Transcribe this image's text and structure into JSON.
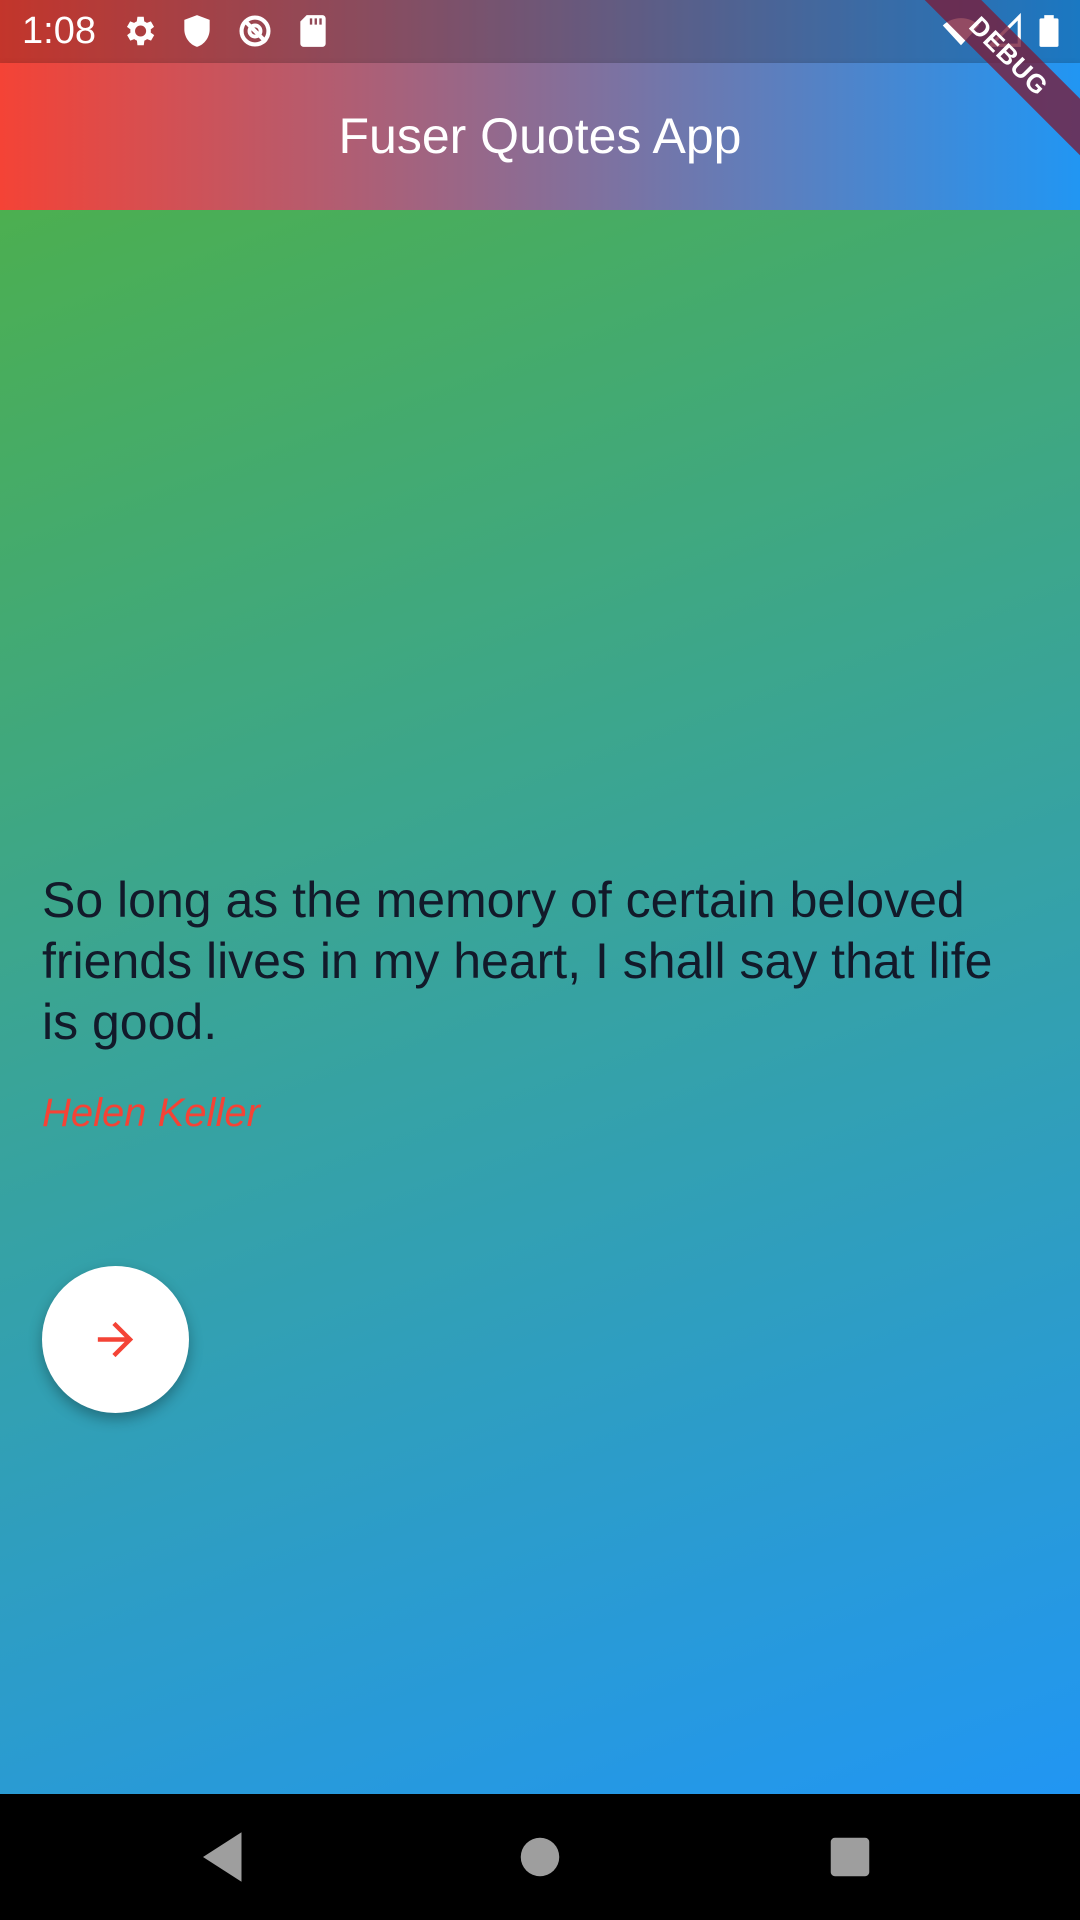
{
  "status_bar": {
    "time": "1:08",
    "icons": [
      "gear-icon",
      "shield-icon",
      "no-sync-icon",
      "sd-card-icon",
      "wifi-icon",
      "signal-icon",
      "battery-icon"
    ]
  },
  "debug_banner": {
    "label": "DEBUG"
  },
  "app_bar": {
    "title": "Fuser Quotes App"
  },
  "quote": {
    "text": "So long as the memory of certain beloved friends lives in my heart, I shall say that life is good.",
    "author": "Helen Keller"
  },
  "next_button": {
    "icon": "arrow-forward-icon"
  },
  "nav_bar": {
    "buttons": [
      "back-icon",
      "home-icon",
      "recents-icon"
    ]
  },
  "colors": {
    "app_bar_start": "#f44336",
    "app_bar_end": "#2196f3",
    "body_start": "#4caf50",
    "body_end": "#2196f3",
    "author": "#f44336",
    "quote_text": "#121a2a",
    "fab_background": "#ffffff",
    "fab_icon": "#f44336"
  }
}
